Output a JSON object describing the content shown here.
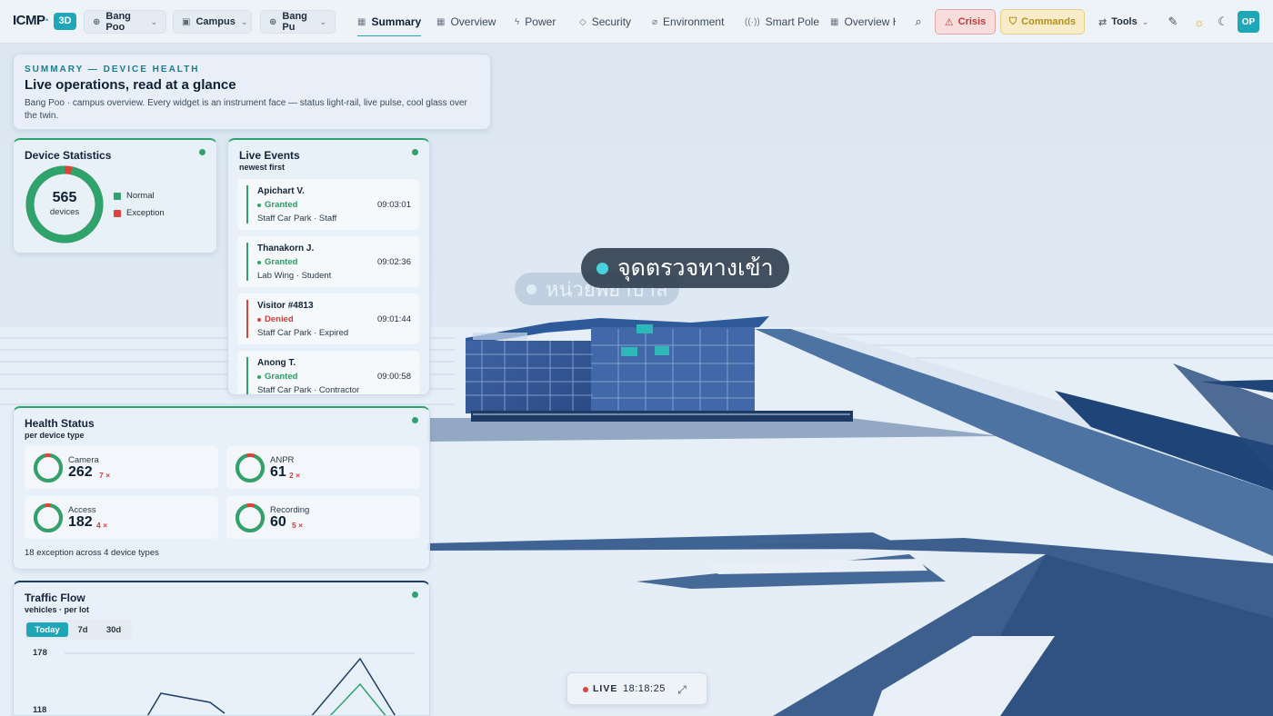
{
  "app": {
    "logo": "ICMP",
    "logo_badge": "3D",
    "brand_color": "#1fa7b8"
  },
  "selectors": [
    {
      "label": "Bang Poo",
      "icon": "globe-icon"
    },
    {
      "label": "Campus",
      "icon": "building-icon"
    },
    {
      "label": "Bang Pu",
      "icon": "globe-icon"
    }
  ],
  "nav": [
    {
      "label": "Summary",
      "icon": "grid-icon",
      "active": true
    },
    {
      "label": "Overview",
      "icon": "grid-icon"
    },
    {
      "label": "Power",
      "icon": "bolt-icon"
    },
    {
      "label": "Security",
      "icon": "shield-icon"
    },
    {
      "label": "Environment",
      "icon": "leaf-icon"
    },
    {
      "label": "Smart Pole",
      "icon": "signal-icon"
    },
    {
      "label": "Overview H",
      "icon": "grid-icon"
    }
  ],
  "actions": {
    "crisis": "Crisis",
    "commands": "Commands",
    "tools": "Tools",
    "avatar": "OP"
  },
  "summary": {
    "kicker": "SUMMARY — DEVICE HEALTH",
    "title": "Live operations, read at a glance",
    "description": "Bang Poo · campus overview. Every widget is an instrument face — status light-rail, live pulse, cool glass over the twin."
  },
  "device_stats": {
    "title": "Device Statistics",
    "total": "565",
    "unit": "devices",
    "normal_label": "Normal",
    "exception_label": "Exception",
    "normal_fraction": 0.968,
    "normal_color": "#2ea36b",
    "exception_color": "#d9443b"
  },
  "live_events": {
    "title": "Live Events",
    "subtitle": "newest first",
    "items": [
      {
        "name": "Apichart V.",
        "status": "Granted",
        "meta": "Staff Car Park · Staff",
        "time": "09:03:01",
        "ok": true
      },
      {
        "name": "Thanakorn J.",
        "status": "Granted",
        "meta": "Lab Wing · Student",
        "time": "09:02:36",
        "ok": true
      },
      {
        "name": "Visitor #4813",
        "status": "Denied",
        "meta": "Staff Car Park · Expired",
        "time": "09:01:44",
        "ok": false
      },
      {
        "name": "Anong T.",
        "status": "Granted",
        "meta": "Staff Car Park · Contractor",
        "time": "09:00:58",
        "ok": true
      }
    ]
  },
  "health_status": {
    "title": "Health Status",
    "subtitle": "per device type",
    "types": [
      {
        "label": "Camera",
        "value": "262",
        "exceptions": "7"
      },
      {
        "label": "ANPR",
        "value": "61",
        "exceptions": "2"
      },
      {
        "label": "Access",
        "value": "182",
        "exceptions": "4"
      },
      {
        "label": "Recording",
        "value": "60",
        "exceptions": "5"
      }
    ],
    "footer": "18 exception across 4 device types"
  },
  "traffic_flow": {
    "title": "Traffic Flow",
    "subtitle": "vehicles · per lot",
    "tabs": [
      "Today",
      "7d",
      "30d"
    ],
    "active_tab": "Today",
    "y_labels": [
      "178",
      "118"
    ]
  },
  "scene_labels": [
    {
      "text": "จุดตรวจทางเข้า"
    },
    {
      "text": "หน่วยพยาบาล"
    }
  ],
  "live": {
    "label": "LIVE",
    "time": "18:18:25"
  }
}
